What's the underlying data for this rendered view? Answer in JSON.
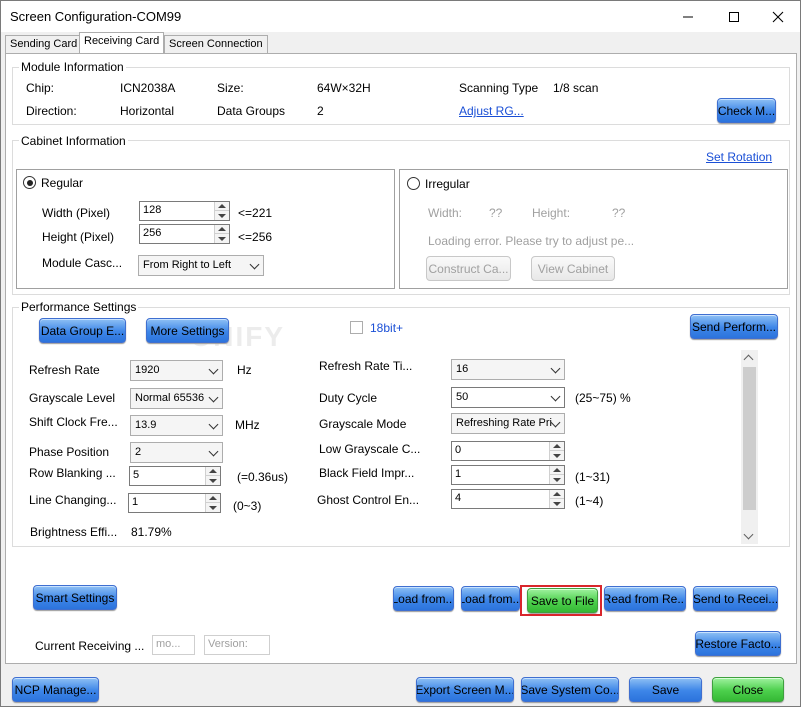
{
  "window": {
    "title": "Screen Configuration-COM99",
    "tabs": [
      "Sending Card",
      "Receiving Card",
      "Screen Connection"
    ],
    "active_tab": "Receiving Card"
  },
  "module": {
    "title": "Module Information",
    "chip_label": "Chip:",
    "chip": "ICN2038A",
    "size_label": "Size:",
    "size": "64W×32H",
    "scan_label": "Scanning Type",
    "scan": "1/8 scan",
    "direction_label": "Direction:",
    "direction": "Horizontal",
    "groups_label": "Data Groups",
    "groups": "2",
    "adjust_link": "Adjust RG...",
    "check_button": "Check M..."
  },
  "cabinet": {
    "title": "Cabinet Information",
    "set_rotation": "Set Rotation",
    "regular": {
      "label": "Regular",
      "selected": true,
      "width_label": "Width (Pixel)",
      "width": "128",
      "width_max": "<=221",
      "height_label": "Height (Pixel)",
      "height": "256",
      "height_max": "<=256",
      "cascade_label": "Module Casc...",
      "cascade": "From Right to Left"
    },
    "irregular": {
      "label": "Irregular",
      "selected": false,
      "width_label": "Width:",
      "width": "??",
      "height_label": "Height:",
      "height": "??",
      "error": "Loading error. Please try to adjust pe...",
      "construct_button": "Construct Ca...",
      "view_button": "View Cabinet"
    }
  },
  "performance": {
    "title": "Performance Settings",
    "data_group_button": "Data Group E...",
    "more_settings_button": "More Settings",
    "bit18_label": "18bit+",
    "send_button": "Send Perform...",
    "watermark": "UNIFY",
    "left": {
      "refresh_rate": {
        "label": "Refresh Rate",
        "value": "1920",
        "unit": "Hz"
      },
      "grayscale_level": {
        "label": "Grayscale Level",
        "value": "Normal 65536"
      },
      "shift_clock": {
        "label": "Shift Clock Fre...",
        "value": "13.9",
        "unit": "MHz"
      },
      "phase_position": {
        "label": "Phase Position",
        "value": "2"
      },
      "row_blanking": {
        "label": "Row Blanking ...",
        "value": "5",
        "note": "(=0.36us)"
      },
      "line_changing": {
        "label": "Line Changing...",
        "value": "1",
        "note": "(0~3)"
      },
      "brightness": {
        "label": "Brightness Effi...",
        "value": "81.79%"
      }
    },
    "right": {
      "refresh_multiple": {
        "label": "Refresh Rate Ti...",
        "value": "16"
      },
      "duty_cycle": {
        "label": "Duty Cycle",
        "value": "50",
        "note": "(25~75) %"
      },
      "grayscale_mode": {
        "label": "Grayscale Mode",
        "value": "Refreshing Rate Pri"
      },
      "low_grayscale": {
        "label": "Low Grayscale C...",
        "value": "0"
      },
      "black_field": {
        "label": "Black Field Impr...",
        "value": "1",
        "note": "(1~31)"
      },
      "ghost_control": {
        "label": "Ghost Control En...",
        "value": "4",
        "note": "(1~4)"
      }
    }
  },
  "actions": {
    "smart_settings": "Smart Settings",
    "load_from_1": "Load from...",
    "load_from_2": "Load from...",
    "save_to_file": "Save to File",
    "read_from": "Read from Re...",
    "send_to": "Send to Recei...",
    "current_label": "Current Receiving ...",
    "model_placeholder": "mo...",
    "version_placeholder": "Version:",
    "restore": "Restore Facto..."
  },
  "footer": {
    "ncp": "NCP Manage...",
    "export": "Export Screen M...",
    "save_system": "Save System Co...",
    "save": "Save",
    "close": "Close"
  },
  "colors": {
    "button_blue": "#3d86e8",
    "button_green": "#4ccf4c",
    "highlight": "#d9262c",
    "link": "#1a4fd6"
  }
}
